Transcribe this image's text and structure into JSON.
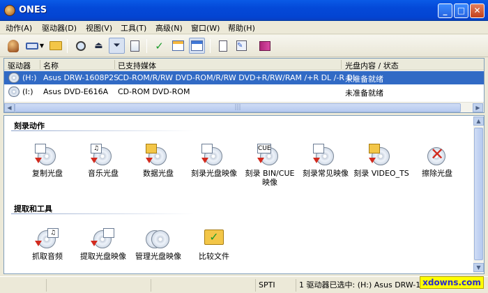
{
  "window": {
    "title": "ONES",
    "minimize": "_",
    "maximize": "□",
    "close": "✕"
  },
  "menu": [
    "动作(A)",
    "驱动器(D)",
    "视图(V)",
    "工具(T)",
    "高级(N)",
    "窗口(W)",
    "帮助(H)"
  ],
  "toolbar": {
    "buttons": [
      "ones-icon",
      "eject-dropdown-icon",
      "open-folder-icon",
      "search-disc-icon",
      "eject-icon",
      "load-icon",
      "page-icon",
      "checkmark-icon",
      "list-view-icon",
      "detail-view-icon",
      "document-icon",
      "edit-icon",
      "book-icon"
    ],
    "logo": "ones"
  },
  "drive_list": {
    "columns": [
      "驱动器",
      "名称",
      "已支持媒体",
      "光盘内容 / 状态"
    ],
    "rows": [
      {
        "drive": "(H:)",
        "name": "Asus DRW-1608P2S",
        "media": "CD-ROM/R/RW DVD-ROM/R/RW DVD+R/RW/RAM /+R DL /-R DL",
        "status": "未准备就绪",
        "selected": true
      },
      {
        "drive": "(I:)",
        "name": "Asus DVD-E616A",
        "media": "CD-ROM DVD-ROM",
        "status": "未准备就绪",
        "selected": false
      }
    ]
  },
  "sections": [
    {
      "title": "刻录动作",
      "tasks": [
        {
          "label": "复制光盘",
          "icon": "copy-disc-icon"
        },
        {
          "label": "音乐光盘",
          "icon": "music-disc-icon"
        },
        {
          "label": "数据光盘",
          "icon": "data-disc-icon"
        },
        {
          "label": "刻录光盘映像",
          "icon": "burn-image-icon"
        },
        {
          "label": "刻录 BIN/CUE 映像",
          "icon": "burn-bincue-icon"
        },
        {
          "label": "刻录常见映像",
          "icon": "burn-common-image-icon"
        },
        {
          "label": "刻录 VIDEO_TS",
          "icon": "burn-video-ts-icon"
        },
        {
          "label": "擦除光盘",
          "icon": "erase-disc-icon"
        }
      ]
    },
    {
      "title": "提取和工具",
      "tasks": [
        {
          "label": "抓取音频",
          "icon": "rip-audio-icon"
        },
        {
          "label": "提取光盘映像",
          "icon": "extract-image-icon"
        },
        {
          "label": "管理光盘映像",
          "icon": "manage-image-icon"
        },
        {
          "label": "比较文件",
          "icon": "compare-files-icon"
        }
      ]
    }
  ],
  "status": {
    "interface": "SPTI",
    "selection": "1 驱动器已选中: (H:) Asus DRW-1608P2S"
  },
  "watermark": "xdowns.com",
  "colors": {
    "selection": "#316ac5",
    "title_bar": "#0449d8",
    "arrow_red": "#d22a1e"
  }
}
